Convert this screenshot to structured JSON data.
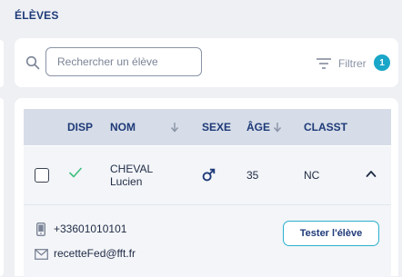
{
  "page": {
    "title": "ÉLÈVES"
  },
  "search": {
    "placeholder": "Rechercher un élève",
    "value": ""
  },
  "filter": {
    "label": "Filtrer",
    "count": "1",
    "badge_color": "#1aa6c8"
  },
  "table": {
    "columns": {
      "disp": "DISP",
      "nom": "NOM",
      "sexe": "SEXE",
      "age": "ÂGE",
      "classt": "CLASST"
    },
    "rows": [
      {
        "name_line1": "CHEVAL",
        "name_line2": "Lucien",
        "disp_icon": "check-icon",
        "sex_icon": "male-icon",
        "age": "35",
        "classt": "NC",
        "expanded": true,
        "detail": {
          "phone": "+33601010101",
          "email": "recetteFed@fft.fr",
          "action_label": "Tester l'élève"
        }
      }
    ]
  },
  "colors": {
    "accent": "#1aa6c8",
    "heading": "#1e3a78",
    "check": "#3fbf7f",
    "header_bg": "#d6dde8"
  }
}
